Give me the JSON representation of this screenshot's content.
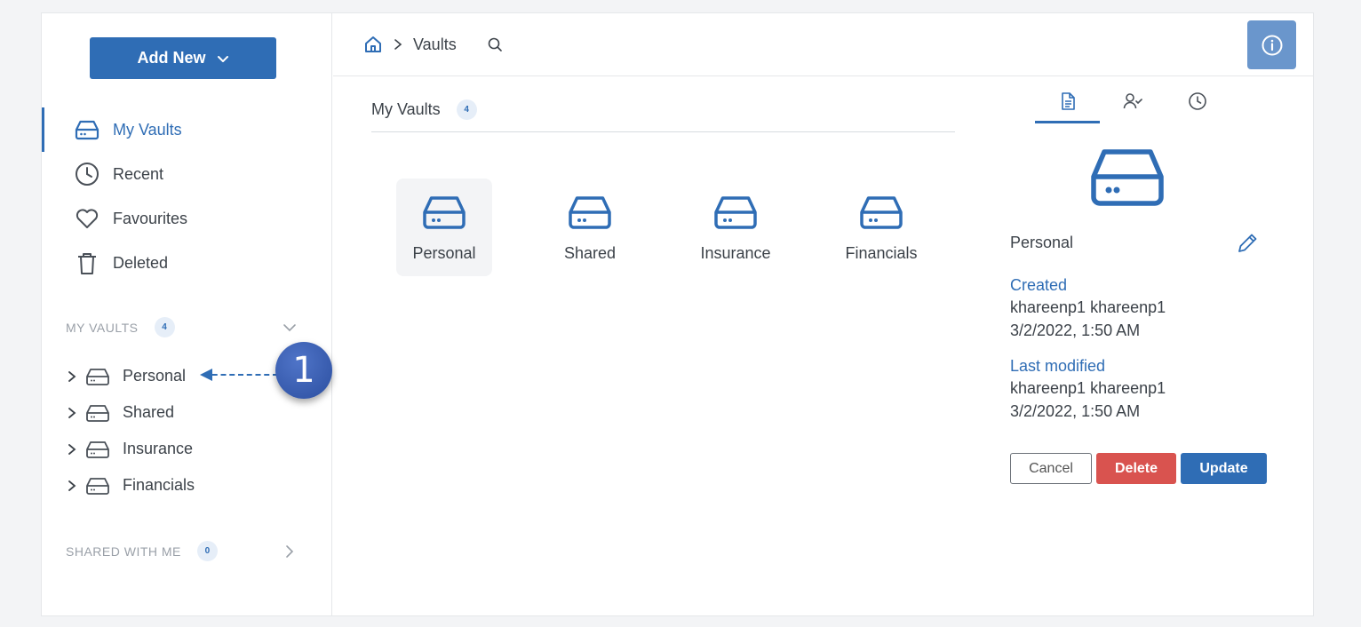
{
  "colors": {
    "accent": "#2f6db5",
    "danger": "#d9534f",
    "info_button": "#6a96cc"
  },
  "sidebar": {
    "add_new_label": "Add New",
    "nav": [
      {
        "label": "My Vaults",
        "icon": "drive-icon"
      },
      {
        "label": "Recent",
        "icon": "clock-icon"
      },
      {
        "label": "Favourites",
        "icon": "heart-icon"
      },
      {
        "label": "Deleted",
        "icon": "trash-icon"
      }
    ],
    "my_vaults_header": "MY VAULTS",
    "my_vaults_count": "4",
    "tree": [
      {
        "label": "Personal"
      },
      {
        "label": "Shared"
      },
      {
        "label": "Insurance"
      },
      {
        "label": "Financials"
      }
    ],
    "shared_header": "SHARED WITH ME",
    "shared_count": "0",
    "callout_number": "1"
  },
  "topbar": {
    "breadcrumb": "Vaults"
  },
  "main": {
    "title": "My Vaults",
    "count": "4",
    "vaults": [
      {
        "label": "Personal"
      },
      {
        "label": "Shared"
      },
      {
        "label": "Insurance"
      },
      {
        "label": "Financials"
      }
    ]
  },
  "details": {
    "name": "Personal",
    "created_label": "Created",
    "created_by": "khareenp1 khareenp1",
    "created_at": "3/2/2022, 1:50 AM",
    "modified_label": "Last modified",
    "modified_by": "khareenp1 khareenp1",
    "modified_at": "3/2/2022, 1:50 AM",
    "cancel_label": "Cancel",
    "delete_label": "Delete",
    "update_label": "Update"
  }
}
